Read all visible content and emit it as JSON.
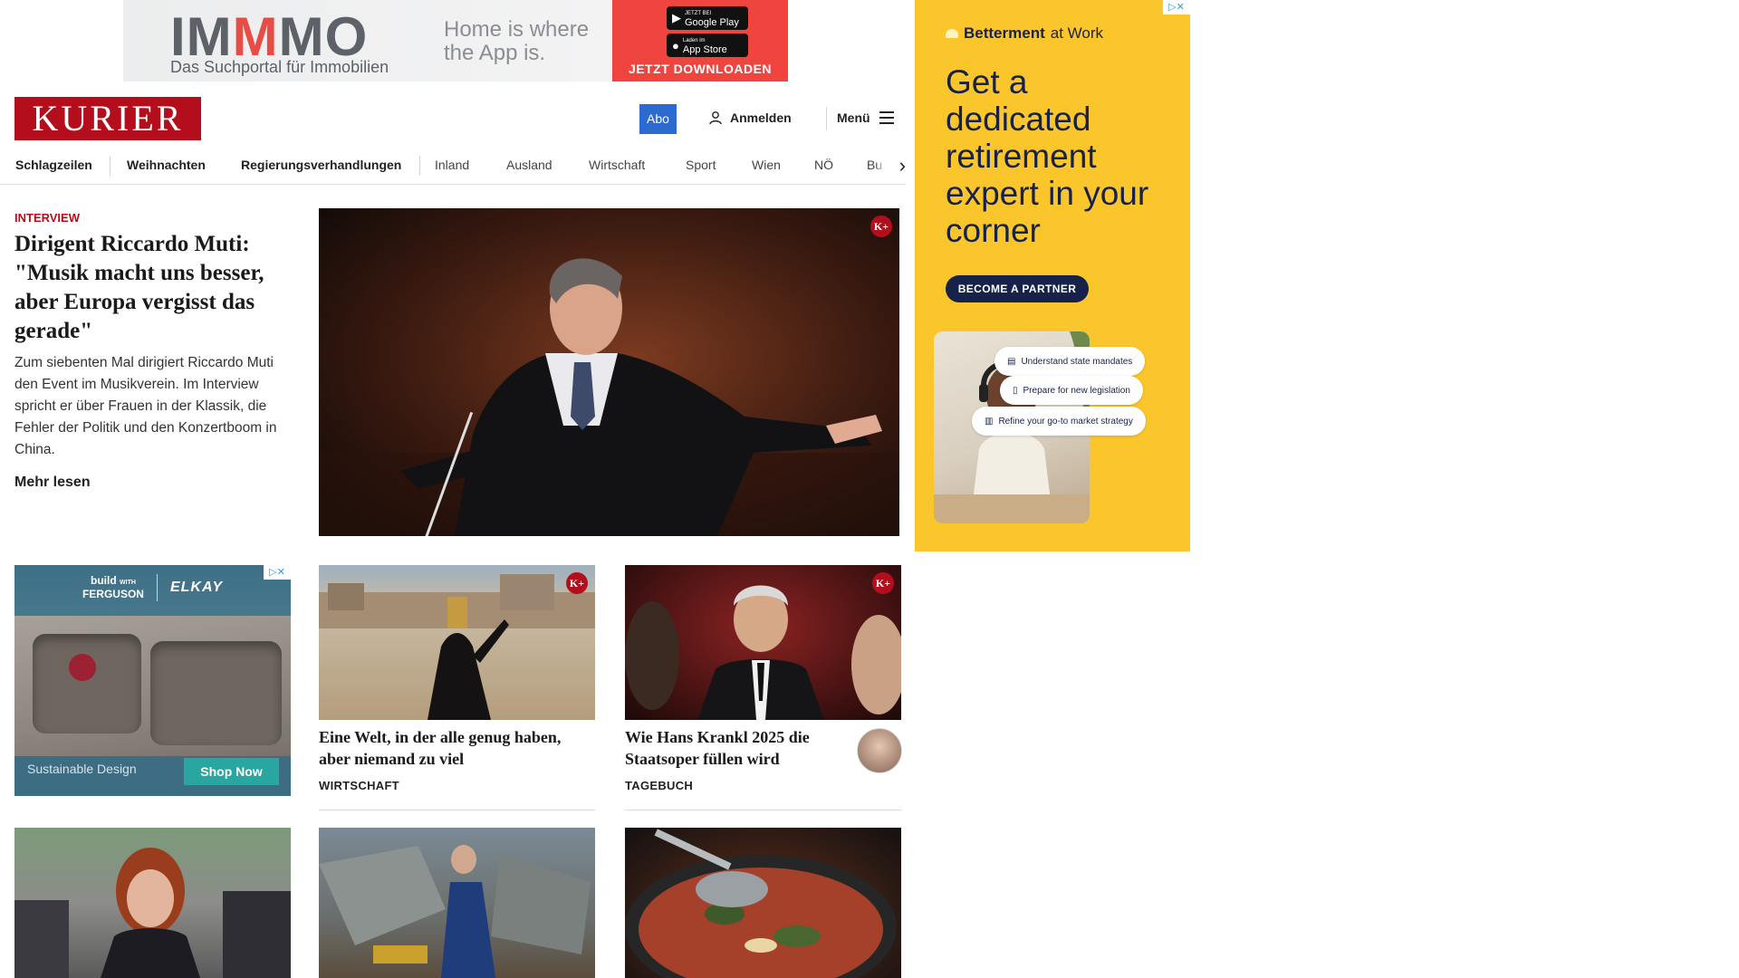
{
  "top_ad": {
    "logo_part1": "IM",
    "logo_part2": "M",
    "logo_part3": "MO",
    "logo_sub": "Das Suchportal für Immobilien",
    "claim": "Home is where the App is.",
    "store1_small": "JETZT BEI",
    "store1": "Google Play",
    "store2_small": "Laden im",
    "store2": "App Store",
    "cta": "JETZT DOWNLOADEN"
  },
  "header": {
    "logo": "KURIER",
    "abo": "Abo",
    "login": "Anmelden",
    "menu": "Menü"
  },
  "nav": {
    "items": [
      "Schlagzeilen",
      "Weihnachten",
      "Regierungsverhandlungen",
      "Inland",
      "Ausland",
      "Wirtschaft",
      "Sport",
      "Wien",
      "NÖ",
      "Bu"
    ]
  },
  "lead": {
    "kicker": "INTERVIEW",
    "title": "Dirigent Riccardo Muti: \"Musik macht uns besser, aber Europa vergisst das gerade\"",
    "teaser": "Zum siebenten Mal dirigiert Riccardo Muti den Event im Musikverein. Im Interview spricht er über Frauen in der Klassik, die Fehler der Politik und den Konzertboom in China.",
    "more": "Mehr lesen",
    "badge": "K+"
  },
  "side_ad": {
    "brand_bold": "Betterment",
    "brand_light": "at Work",
    "headline": "Get a dedicated retirement expert in your corner",
    "cta": "BECOME A PARTNER",
    "pills": [
      "Understand state mandates",
      "Prepare for new legislation",
      "Refine your go-to market strategy"
    ]
  },
  "mid_ad": {
    "brand1_top": "build",
    "brand1_small": "WITH",
    "brand1_bottom": "FERGUSON",
    "brand2": "ELKAY",
    "text": "Sustainable Design",
    "cta": "Shop Now"
  },
  "cards": [
    {
      "title": "Eine Welt, in der alle genug haben, aber niemand zu viel",
      "category": "WIRTSCHAFT",
      "badge": "K+"
    },
    {
      "title": "Wie Hans Krankl 2025 die Staatsoper füllen wird",
      "category": "TAGEBUCH",
      "badge": "K+"
    }
  ],
  "colors": {
    "brand_red": "#b40e1c",
    "abo_blue": "#2c6ad0",
    "ad_yellow": "#fbc52c",
    "ad_navy": "#17224a"
  }
}
